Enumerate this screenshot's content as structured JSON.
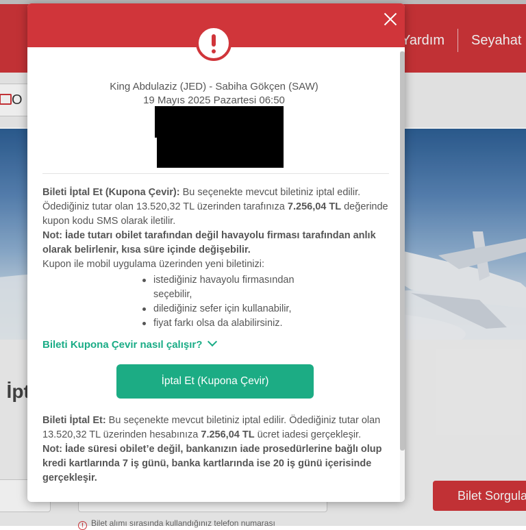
{
  "background": {
    "nav": {
      "help_label": "Yardım",
      "travel_label": "Seyahat"
    },
    "subbar": {
      "chip_label": "O"
    },
    "heading": ", İpt",
    "query_button_label": "Bilet Sorgula",
    "phone_hint": "Bilet alımı sırasında kullandığınız telefon numarası"
  },
  "modal": {
    "alert_icon": "exclamation-circle-icon",
    "close_icon": "close-icon",
    "route": "King Abdulaziz (JED) - Sabiha Gökçen (SAW)",
    "date": "19 Mayıs 2025 Pazartesi 06:50",
    "coupon_section": {
      "title": "Bileti İptal Et (Kupona Çevir):",
      "text1": " Bu seçenekte mevcut biletiniz iptal edilir. Ödediğiniz tutar olan 13.520,32 TL üzerinden tarafınıza ",
      "amount": "7.256,04 TL",
      "text2": " değerinde kupon kodu SMS olarak iletilir.",
      "note": "Not: İade tutarı obilet tarafından değil havayolu firması tarafından anlık olarak belirlenir, kısa süre içinde değişebilir.",
      "bullets_intro": "Kupon ile mobil uygulama üzerinden yeni biletinizi:",
      "bullets": [
        "istediğiniz havayolu firmasından seçebilir,",
        "dilediğiniz sefer için kullanabilir,",
        "fiyat farkı olsa da alabilirsiniz."
      ]
    },
    "howto_link": "Bileti Kupona Çevir nasıl çalışır?",
    "coupon_button": "İptal Et (Kupona Çevir)",
    "refund_section": {
      "title": "Bileti İptal Et:",
      "text1": " Bu seçenekte mevcut biletiniz iptal edilir. Ödediğiniz tutar olan 13.520,32 TL üzerinden hesabınıza ",
      "amount": "7.256,04 TL",
      "text2": " ücret iadesi gerçekleşir.",
      "note": "Not: İade süresi obilet’e değil, bankanızın iade prosedürlerine bağlı olup kredi kartlarında 7 iş günü, banka kartlarında ise 20 iş günü içerisinde gerçekleşir."
    }
  },
  "colors": {
    "brand_red": "#d0353a",
    "action_green": "#1cac84",
    "link_green": "#1aac86"
  }
}
